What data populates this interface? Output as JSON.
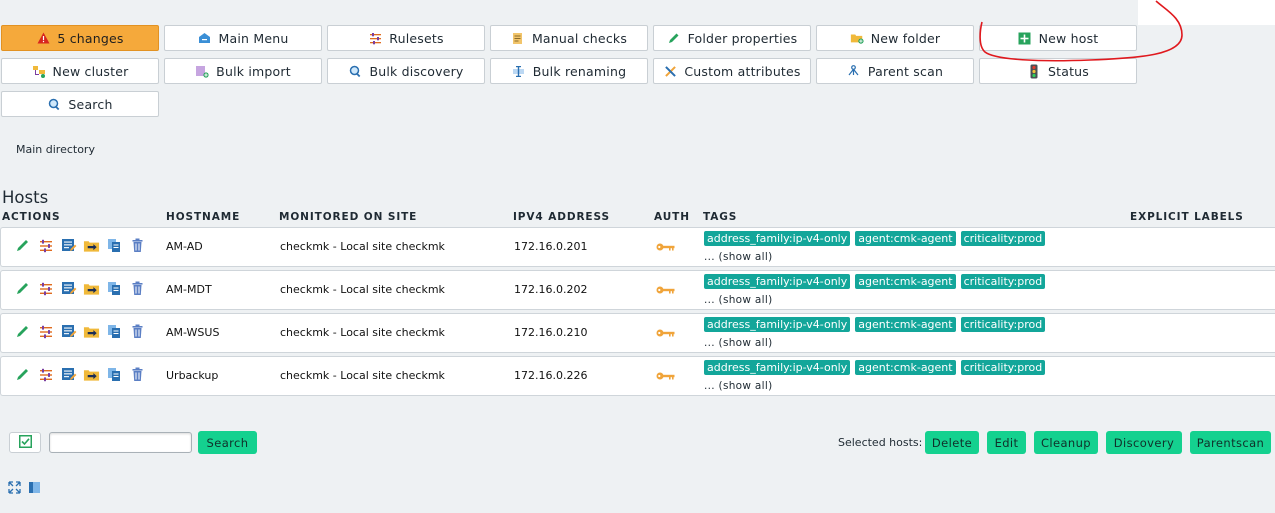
{
  "toolbar": {
    "row1": [
      {
        "label": "5 changes",
        "icon": "warning-icon"
      },
      {
        "label": "Main Menu",
        "icon": "home-icon"
      },
      {
        "label": "Rulesets",
        "icon": "rulesets-icon"
      },
      {
        "label": "Manual checks",
        "icon": "manual-checks-icon"
      },
      {
        "label": "Folder properties",
        "icon": "pencil-icon"
      },
      {
        "label": "New folder",
        "icon": "new-folder-icon"
      },
      {
        "label": "New host",
        "icon": "plus-icon"
      }
    ],
    "row2": [
      {
        "label": "New cluster",
        "icon": "cluster-icon"
      },
      {
        "label": "Bulk import",
        "icon": "bulk-import-icon"
      },
      {
        "label": "Bulk discovery",
        "icon": "search-icon"
      },
      {
        "label": "Bulk renaming",
        "icon": "rename-icon"
      },
      {
        "label": "Custom attributes",
        "icon": "tools-icon"
      },
      {
        "label": "Parent scan",
        "icon": "parent-scan-icon"
      },
      {
        "label": "Status",
        "icon": "traffic-light-icon"
      }
    ],
    "row3": [
      {
        "label": "Search",
        "icon": "search-icon"
      }
    ]
  },
  "breadcrumb": "Main directory",
  "hosts_title": "Hosts",
  "columns": {
    "actions": "ACTIONS",
    "hostname": "HOSTNAME",
    "site": "MONITORED ON SITE",
    "ipv4": "IPV4 ADDRESS",
    "auth": "AUTH",
    "tags": "TAGS",
    "labels": "EXPLICIT LABELS"
  },
  "hosts": [
    {
      "hostname": "AM-AD",
      "site": "checkmk - Local site checkmk",
      "ipv4": "172.16.0.201",
      "tags": [
        "address_family:ip-v4-only",
        "agent:cmk-agent",
        "criticality:prod"
      ],
      "show_all": "... (show all)"
    },
    {
      "hostname": "AM-MDT",
      "site": "checkmk - Local site checkmk",
      "ipv4": "172.16.0.202",
      "tags": [
        "address_family:ip-v4-only",
        "agent:cmk-agent",
        "criticality:prod"
      ],
      "show_all": "... (show all)"
    },
    {
      "hostname": "AM-WSUS",
      "site": "checkmk - Local site checkmk",
      "ipv4": "172.16.0.210",
      "tags": [
        "address_family:ip-v4-only",
        "agent:cmk-agent",
        "criticality:prod"
      ],
      "show_all": "... (show all)"
    },
    {
      "hostname": "Urbackup",
      "site": "checkmk - Local site checkmk",
      "ipv4": "172.16.0.226",
      "tags": [
        "address_family:ip-v4-only",
        "agent:cmk-agent",
        "criticality:prod"
      ],
      "show_all": "... (show all)"
    }
  ],
  "footer": {
    "search_value": "",
    "search_button": "Search",
    "selected_label": "Selected hosts:",
    "buttons": [
      "Delete",
      "Edit",
      "Cleanup",
      "Discovery",
      "Parentscan"
    ]
  },
  "colors": {
    "accent_green": "#14d18f",
    "tag_teal": "#13a69a",
    "changes_orange": "#f5a93b",
    "annotation_red": "#e0191e"
  }
}
